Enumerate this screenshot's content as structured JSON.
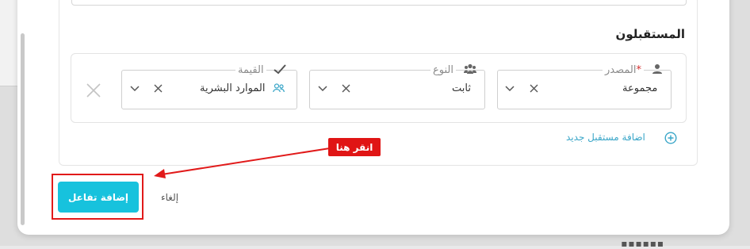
{
  "section": {
    "title": "المستقبلون"
  },
  "recipient_row": {
    "source_label": "المصدر",
    "source_required_mark": "*",
    "source_value": "مجموعة",
    "type_label": "النوع",
    "type_value": "ثابت",
    "value_label": "القيمة",
    "value_value": "الموارد البشرية"
  },
  "links": {
    "add_recipient": "اضافة مستقبل جديد",
    "cancel": "إلغاء"
  },
  "buttons": {
    "add_interaction": "إضافة تفاعل"
  },
  "annotation": {
    "callout_text": "انقر هنا"
  },
  "colors": {
    "accent": "#17c2dd",
    "link": "#3aa6c8",
    "annotation_red": "#e11a1a",
    "required": "#d32f2f"
  },
  "icons": [
    "user-icon",
    "users-icon",
    "check-icon",
    "group-icon",
    "clear-x-icon",
    "chevron-down-icon",
    "remove-row-icon",
    "plus-circle-icon"
  ]
}
